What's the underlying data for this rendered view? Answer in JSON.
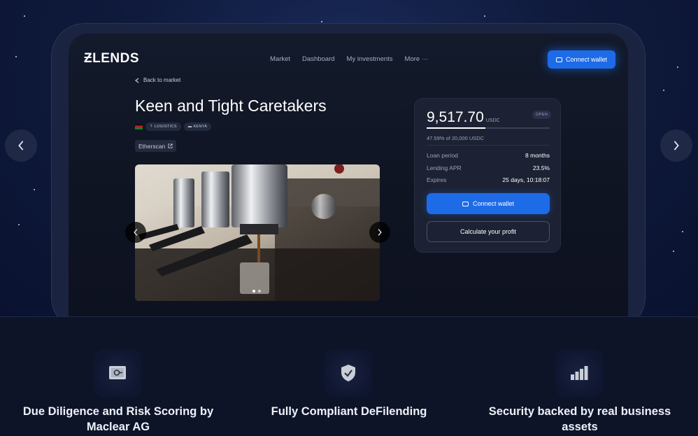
{
  "app": {
    "logo": "ƵLENDS",
    "nav": [
      "Market",
      "Dashboard",
      "My investments",
      "More ···"
    ],
    "connect_wallet": "Connect wallet"
  },
  "listing": {
    "back": "Back to market",
    "title": "Keen and Tight Caretakers",
    "tags": [
      "LOGISTICS",
      "KENYA"
    ],
    "etherscan": "Etherscan"
  },
  "card": {
    "amount": "9,517.70",
    "currency": "USDC",
    "status": "OPEN",
    "progress_fraction": 0.4759,
    "progress_text": "47.59% of 20,000 USDC",
    "rows": [
      {
        "label": "Loan period",
        "value": "8 months"
      },
      {
        "label": "Lending APR",
        "value": "23.5%"
      },
      {
        "label": "Expires",
        "value": "25 days, 10:18:07"
      }
    ],
    "connect_wallet": "Connect wallet",
    "calculate": "Calculate your profit"
  },
  "gallery": {
    "slides": 2,
    "active": 0
  },
  "features": [
    {
      "icon": "safe-icon",
      "text": "Due Diligence and Risk Scoring by Maclear AG"
    },
    {
      "icon": "shield-check-icon",
      "text": "Fully Compliant DeFilending"
    },
    {
      "icon": "bar-chart-icon",
      "text": "Security backed by real business assets"
    }
  ]
}
